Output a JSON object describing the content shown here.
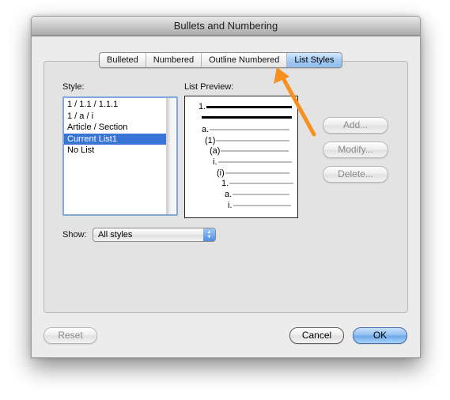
{
  "window": {
    "title": "Bullets and Numbering"
  },
  "tabs": [
    {
      "label": "Bulleted",
      "active": false
    },
    {
      "label": "Numbered",
      "active": false
    },
    {
      "label": "Outline Numbered",
      "active": false
    },
    {
      "label": "List Styles",
      "active": true
    }
  ],
  "style_panel": {
    "label": "Style:",
    "items": [
      "1 / 1.1 / 1.1.1",
      "1 / a / i",
      "Article / Section",
      "Current List1",
      "No List"
    ],
    "selected_index": 3
  },
  "preview_panel": {
    "label": "List Preview:",
    "levels": [
      "1.",
      "",
      "a.",
      "(1)",
      "(a)",
      "i.",
      "(i)",
      "1.",
      "a.",
      "i."
    ]
  },
  "action_buttons": {
    "add": "Add...",
    "modify": "Modify...",
    "delete": "Delete..."
  },
  "show": {
    "label": "Show:",
    "value": "All styles",
    "arrow_icon": "up-down-chevron-icon"
  },
  "footer": {
    "reset": "Reset",
    "cancel": "Cancel",
    "ok": "OK"
  },
  "annotation": {
    "icon": "orange-arrow-pointer",
    "color": "#f7901e"
  }
}
